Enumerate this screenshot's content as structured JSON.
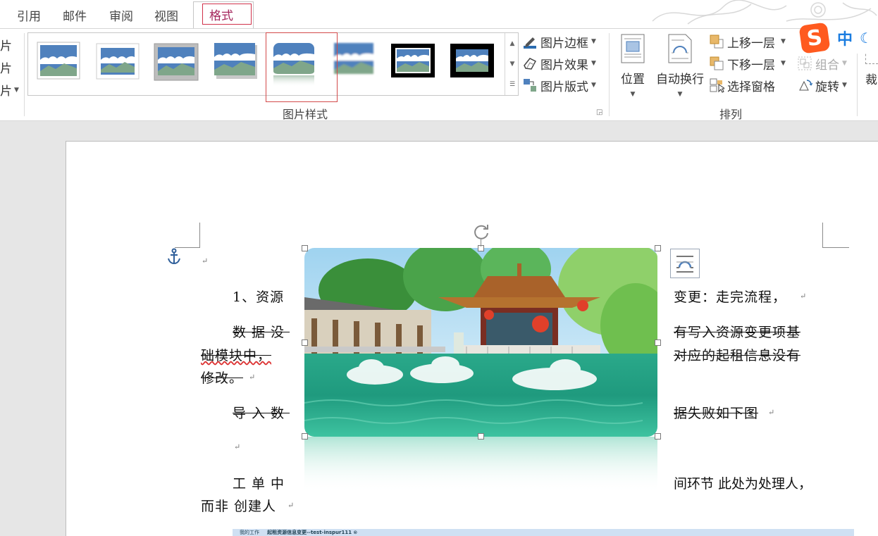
{
  "ribbon": {
    "tabs": [
      "引用",
      "邮件",
      "审阅",
      "视图"
    ],
    "active_tab": "格式",
    "left_stub_labels": [
      "片",
      "片",
      "片"
    ],
    "picture_styles": {
      "group_label": "图片样式",
      "selected_index": 4,
      "commands": {
        "border": "图片边框",
        "effects": "图片效果",
        "layout": "图片版式"
      }
    },
    "arrange": {
      "group_label": "排列",
      "position": "位置",
      "wrap_text": "自动换行",
      "bring_forward": "上移一层",
      "send_backward": "下移一层",
      "selection_pane": "选择窗格",
      "group": "组合",
      "rotate": "旋转"
    },
    "crop_stub": "裁",
    "ime": {
      "logo": "S",
      "lang": "中",
      "mode_icon": "moon-icon"
    }
  },
  "document": {
    "lines": {
      "l1_left": "1、资源",
      "l1_right": "变更：走完流程，",
      "l2_left": "数据没",
      "l2_right": "有写入资源变更项基",
      "l3_left": "础模块中，",
      "l3_right": "对应的起租信息没有",
      "l4_left": "修改。",
      "l5_left": "导入数",
      "l5_right": "据失败如下图",
      "l6_left": "工单中",
      "l6_right": "间环节  此处为处理人，",
      "l7_left": "而非  创建人"
    },
    "paragraph_mark": "↵",
    "embedded_strip": {
      "tab1": "我的工作",
      "tab2": "起租资源信息变更--test-inspur111"
    }
  },
  "colors": {
    "active_tab_text": "#a4265c",
    "selection_outline": "#d34a4a",
    "ime_orange": "#ff5a1f",
    "ime_blue": "#1a7ce0"
  }
}
